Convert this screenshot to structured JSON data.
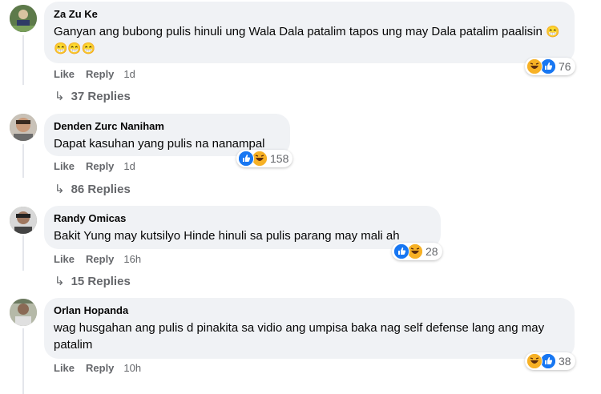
{
  "comments": [
    {
      "author": "Za Zu Ke",
      "text": "Ganyan ang bubong pulis hinuli ung Wala Dala patalim tapos ung may Dala patalim paalisin",
      "emojis": "😁😁😁😁",
      "like": "Like",
      "reply": "Reply",
      "time": "1d",
      "reaction_count": "76",
      "replies": "37 Replies"
    },
    {
      "author": "Denden Zurc Naniham",
      "text": "Dapat kasuhan yang pulis na nanampal",
      "like": "Like",
      "reply": "Reply",
      "time": "1d",
      "reaction_count": "158",
      "replies": "86 Replies"
    },
    {
      "author": "Randy Omicas",
      "text": "Bakit Yung may kutsilyo Hinde hinuli sa pulis parang may mali ah",
      "like": "Like",
      "reply": "Reply",
      "time": "16h",
      "reaction_count": "28",
      "replies": "15 Replies"
    },
    {
      "author": "Orlan Hopanda",
      "text": "wag husgahan ang pulis d pinakita sa vidio ang umpisa baka nag self defense lang ang may patalim",
      "like": "Like",
      "reply": "Reply",
      "time": "10h",
      "reaction_count": "38"
    }
  ],
  "colors": {
    "bubble": "#f0f2f5",
    "like_blue": "#1877f2",
    "haha_yellow": "#f7b125",
    "meta_gray": "#65676b"
  }
}
